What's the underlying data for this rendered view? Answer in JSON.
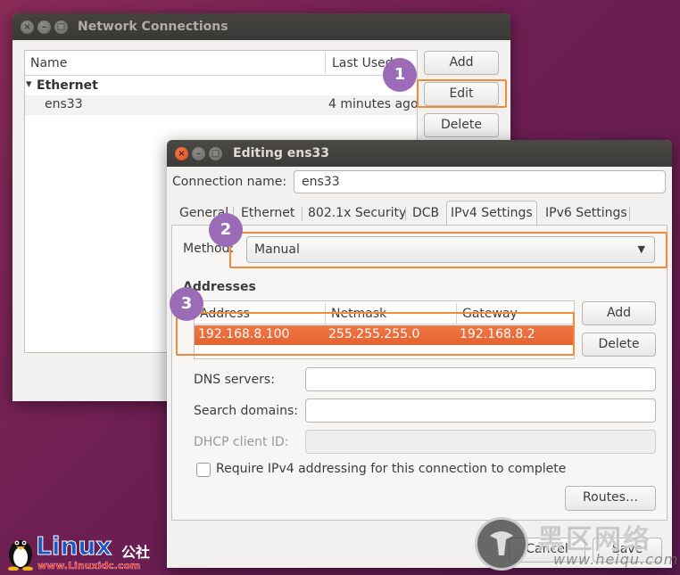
{
  "network_window": {
    "title": "Network Connections",
    "columns": {
      "name": "Name",
      "last_used": "Last Used"
    },
    "group": {
      "arrow": "▾",
      "label": "Ethernet"
    },
    "connections": [
      {
        "name": "ens33",
        "last_used": "4 minutes ago"
      }
    ],
    "buttons": {
      "add": "Add",
      "edit": "Edit",
      "delete": "Delete"
    }
  },
  "editing_window": {
    "title": "Editing ens33",
    "connection_name_label": "Connection name:",
    "connection_name_value": "ens33",
    "tabs": [
      "General",
      "Ethernet",
      "802.1x Security",
      "DCB",
      "IPv4 Settings",
      "IPv6 Settings"
    ],
    "active_tab": "IPv4 Settings",
    "method_label": "Method:",
    "method_value": "Manual",
    "addresses_heading": "Addresses",
    "address_columns": {
      "address": "Address",
      "netmask": "Netmask",
      "gateway": "Gateway"
    },
    "addresses": [
      {
        "address": "192.168.8.100",
        "netmask": "255.255.255.0",
        "gateway": "192.168.8.2"
      }
    ],
    "address_buttons": {
      "add": "Add",
      "delete": "Delete"
    },
    "dns_label": "DNS servers:",
    "dns_value": "",
    "search_label": "Search domains:",
    "search_value": "",
    "dhcp_label": "DHCP client ID:",
    "dhcp_value": "",
    "require_ipv4_label": "Require IPv4 addressing for this connection to complete",
    "require_ipv4_checked": false,
    "routes_button": "Routes…",
    "cancel_button": "Cancel",
    "save_button": "Save"
  },
  "callouts": [
    "1",
    "2",
    "3"
  ],
  "watermarks": {
    "linux_brand": "Linux",
    "linux_brand_cn": "公社",
    "linux_url": "www.Linuxidc.com",
    "heiqu_cn": "黑区网络",
    "heiqu_url": "www.heiqu.com"
  },
  "colors": {
    "accent_orange": "#e5632f",
    "callout_purple": "#9b6bb7",
    "highlight_orange": "#f08a3c"
  }
}
